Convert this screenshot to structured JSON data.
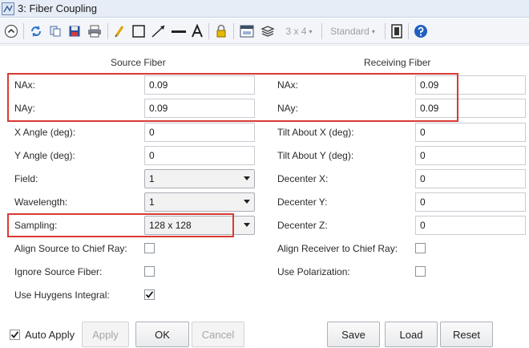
{
  "window": {
    "title": "3: Fiber Coupling"
  },
  "toolbar": {
    "icons": [
      "collapse-icon",
      "refresh-icon",
      "copy-icon",
      "save-icon",
      "print-icon",
      "pencil-icon",
      "rectangle-icon",
      "arrow-line-icon",
      "line-icon",
      "text-icon",
      "lock-icon",
      "window-icon",
      "layers-icon",
      "window-layout-icon",
      "help-icon"
    ],
    "grid_label": "3 x 4",
    "grid_caret": "▾",
    "style_label": "Standard",
    "style_caret": "▾"
  },
  "source": {
    "header": "Source Fiber",
    "nax_label": "NAx:",
    "nax": "0.09",
    "nay_label": "NAy:",
    "nay": "0.09",
    "xangle_label": "X Angle (deg):",
    "xangle": "0",
    "yangle_label": "Y Angle (deg):",
    "yangle": "0",
    "field_label": "Field:",
    "field": "1",
    "wavelength_label": "Wavelength:",
    "wavelength": "1",
    "sampling_label": "Sampling:",
    "sampling": "128 x 128",
    "align_label": "Align Source to Chief Ray:",
    "align_checked": false,
    "ignore_label": "Ignore Source Fiber:",
    "ignore_checked": false,
    "huygens_label": "Use Huygens Integral:",
    "huygens_checked": true
  },
  "receiving": {
    "header": "Receiving Fiber",
    "nax_label": "NAx:",
    "nax": "0.09",
    "nay_label": "NAy:",
    "nay": "0.09",
    "tiltx_label": "Tilt About X (deg):",
    "tiltx": "0",
    "tilty_label": "Tilt About Y (deg):",
    "tilty": "0",
    "decx_label": "Decenter X:",
    "decx": "0",
    "decy_label": "Decenter Y:",
    "decy": "0",
    "decz_label": "Decenter Z:",
    "decz": "0",
    "align_label": "Align Receiver to Chief Ray:",
    "align_checked": false,
    "polar_label": "Use Polarization:",
    "polar_checked": false
  },
  "footer": {
    "auto_apply_label": "Auto Apply",
    "auto_apply_checked": true,
    "apply": "Apply",
    "ok": "OK",
    "cancel": "Cancel",
    "save": "Save",
    "load": "Load",
    "reset": "Reset"
  },
  "colors": {
    "highlight": "#d83a34",
    "titlebar": "#e7edf6",
    "toolbar": "#f3f5f9"
  },
  "check_mark": "✓"
}
